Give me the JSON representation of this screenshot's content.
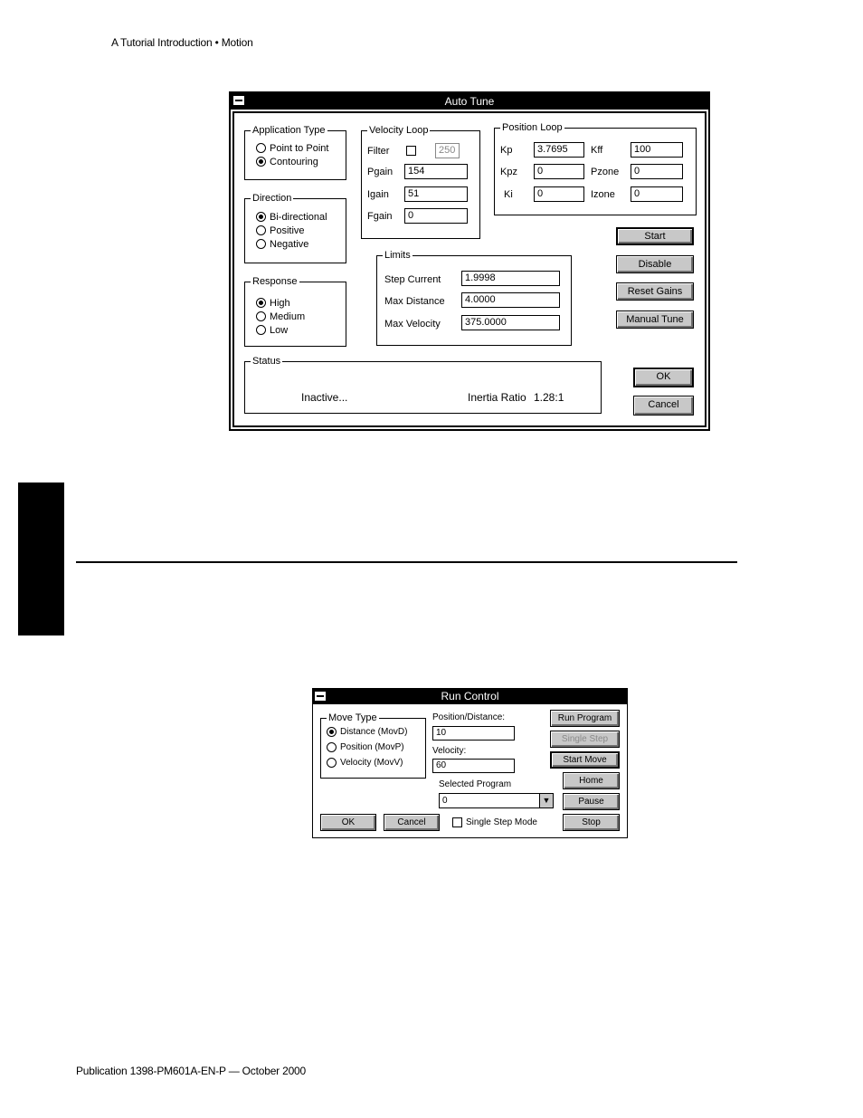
{
  "page": {
    "header": "A Tutorial Introduction • Motion",
    "footer": "Publication 1398-PM601A-EN-P — October 2000"
  },
  "auto_tune": {
    "title": "Auto Tune",
    "application_type": {
      "legend": "Application Type",
      "options": [
        {
          "label": "Point to Point",
          "selected": false
        },
        {
          "label": "Contouring",
          "selected": true
        }
      ]
    },
    "direction": {
      "legend": "Direction",
      "options": [
        {
          "label": "Bi-directional",
          "selected": true
        },
        {
          "label": "Positive",
          "selected": false
        },
        {
          "label": "Negative",
          "selected": false
        }
      ]
    },
    "response": {
      "legend": "Response",
      "options": [
        {
          "label": "High",
          "selected": true
        },
        {
          "label": "Medium",
          "selected": false
        },
        {
          "label": "Low",
          "selected": false
        }
      ]
    },
    "velocity_loop": {
      "legend": "Velocity Loop",
      "filter_label": "Filter",
      "filter_checked": false,
      "filter_value": "250",
      "pgain_label": "Pgain",
      "pgain": "154",
      "igain_label": "Igain",
      "igain": "51",
      "fgain_label": "Fgain",
      "fgain": "0"
    },
    "position_loop": {
      "legend": "Position Loop",
      "kp_label": "Kp",
      "kp": "3.7695",
      "kff_label": "Kff",
      "kff": "100",
      "kpz_label": "Kpz",
      "kpz": "0",
      "pzone_label": "Pzone",
      "pzone": "0",
      "ki_label": "Ki",
      "ki": "0",
      "izone_label": "Izone",
      "izone": "0"
    },
    "limits": {
      "legend": "Limits",
      "step_current_label": "Step Current",
      "step_current": "1.9998",
      "max_distance_label": "Max Distance",
      "max_distance": "4.0000",
      "max_velocity_label": "Max Velocity",
      "max_velocity": "375.0000"
    },
    "buttons": {
      "start": "Start",
      "disable": "Disable",
      "reset_gains": "Reset Gains",
      "manual_tune": "Manual Tune",
      "ok": "OK",
      "cancel": "Cancel"
    },
    "status": {
      "legend": "Status",
      "state": "Inactive...",
      "inertia_label": "Inertia Ratio",
      "inertia_value": "1.28:1"
    }
  },
  "run_control": {
    "title": "Run Control",
    "move_type": {
      "legend": "Move Type",
      "options": [
        {
          "label": "Distance (MovD)",
          "selected": true
        },
        {
          "label": "Position (MovP)",
          "selected": false
        },
        {
          "label": "Velocity (MovV)",
          "selected": false
        }
      ]
    },
    "position_label": "Position/Distance:",
    "position_value": "10",
    "velocity_label": "Velocity:",
    "velocity_value": "60",
    "program_label": "Selected Program",
    "program_value": "0",
    "single_step_mode_label": "Single Step Mode",
    "single_step_mode_checked": false,
    "buttons": {
      "run_program": "Run Program",
      "single_step": "Single Step",
      "start_move": "Start Move",
      "home": "Home",
      "pause": "Pause",
      "stop": "Stop",
      "ok": "OK",
      "cancel": "Cancel"
    }
  }
}
